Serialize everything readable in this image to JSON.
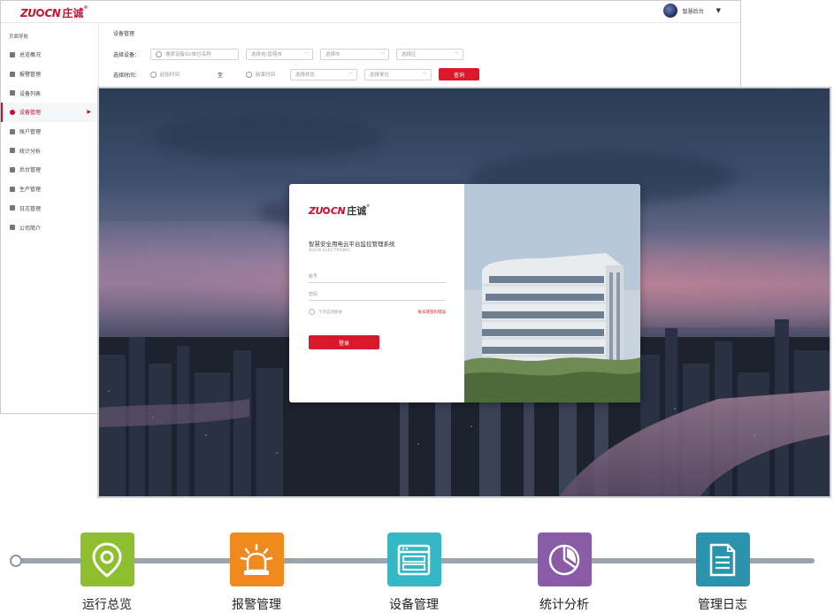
{
  "brand": {
    "logo_latin": "ZU",
    "logo_latin2": "CN",
    "logo_cn": "庄诚",
    "trademark": "®",
    "color": "#c8102e"
  },
  "admin": {
    "user_name": "智慧后台",
    "nav_title": "页面导航",
    "nav_items": [
      {
        "label": "总览概况",
        "icon": "dashboard-icon"
      },
      {
        "label": "报警管理",
        "icon": "alarm-icon"
      },
      {
        "label": "设备列表",
        "icon": "list-icon"
      },
      {
        "label": "设备管理",
        "icon": "device-icon",
        "active": true
      },
      {
        "label": "账户管理",
        "icon": "account-icon"
      },
      {
        "label": "统计分析",
        "icon": "chart-icon"
      },
      {
        "label": "后台管理",
        "icon": "settings-icon"
      },
      {
        "label": "生产管理",
        "icon": "production-icon"
      },
      {
        "label": "日志管理",
        "icon": "log-icon"
      },
      {
        "label": "公司简介",
        "icon": "company-icon"
      }
    ],
    "breadcrumb": "设备管理",
    "filters": {
      "device_label": "选择设备：",
      "search_placeholder": "搜索设备ID/单位名称",
      "type_placeholder": "选择省/直辖市",
      "city_placeholder": "选择市",
      "district_placeholder": "选择区",
      "time_label": "选择时间：",
      "start_placeholder": "起始时间",
      "to": "至",
      "end_placeholder": "结束时间",
      "status_placeholder": "选择状态",
      "unit_placeholder": "选择单位",
      "query_button": "查询"
    }
  },
  "login": {
    "system_title": "智慧安全用电云平台监控管理系统",
    "system_subtitle": "ZUCN ELECTRONIC",
    "account_placeholder": "账号",
    "password_placeholder": "密码",
    "remember_label": "下次自动登录",
    "forgot_label": "账号或密码错误",
    "login_button": "登录"
  },
  "features": [
    {
      "label": "运行总览",
      "icon": "location-pin-icon",
      "color": "#8dbf2f"
    },
    {
      "label": "报警管理",
      "icon": "alarm-light-icon",
      "color": "#f08a1d"
    },
    {
      "label": "设备管理",
      "icon": "device-window-icon",
      "color": "#36b7c6"
    },
    {
      "label": "统计分析",
      "icon": "pie-chart-icon",
      "color": "#8a5ca8"
    },
    {
      "label": "管理日志",
      "icon": "document-icon",
      "color": "#2b93ad"
    }
  ]
}
